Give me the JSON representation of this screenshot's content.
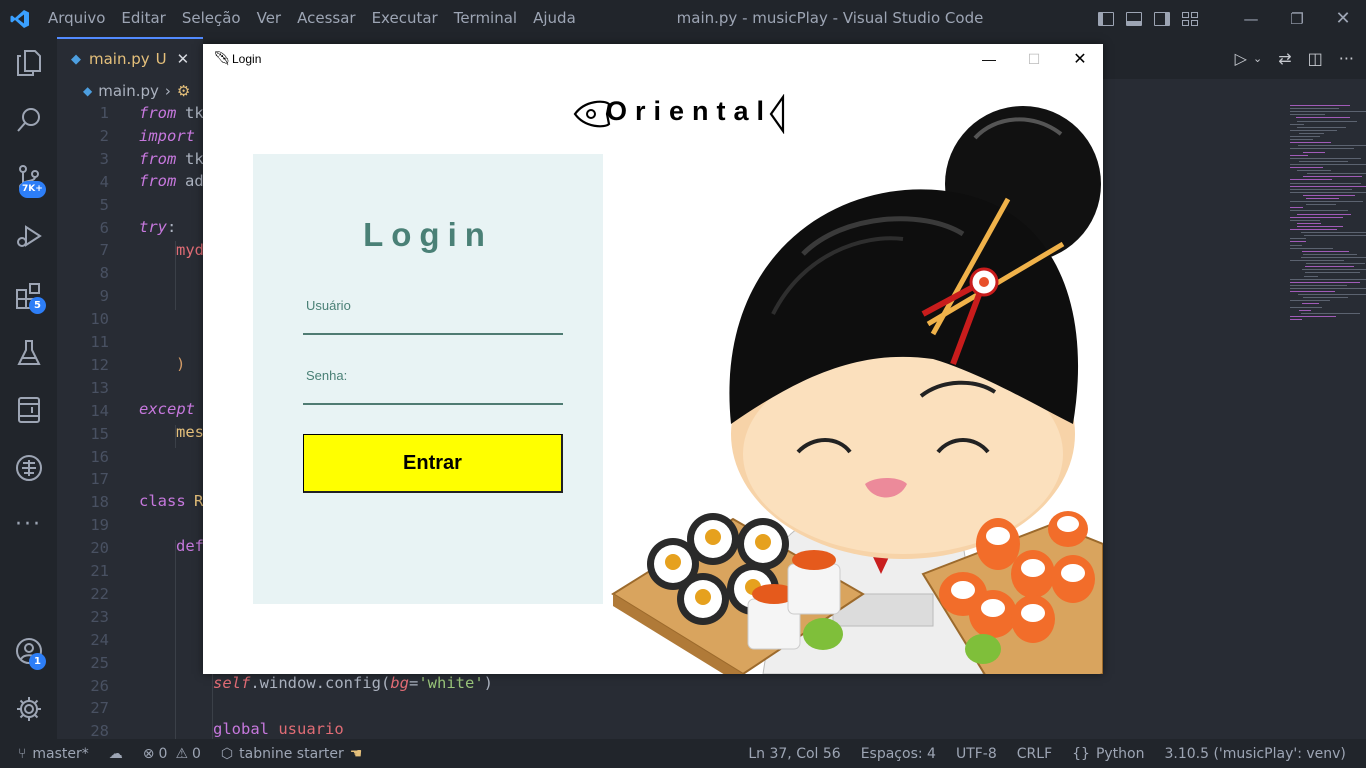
{
  "titlebar": {
    "menu": [
      "Arquivo",
      "Editar",
      "Seleção",
      "Ver",
      "Acessar",
      "Executar",
      "Terminal",
      "Ajuda"
    ],
    "window_title": "main.py - musicPlay - Visual Studio Code"
  },
  "activity": {
    "source_control_badge": "7K+",
    "extensions_badge": "5",
    "accounts_badge": "1"
  },
  "tab": {
    "filename": "main.py",
    "status": "U"
  },
  "breadcrumb": {
    "file": "main.py"
  },
  "editor": {
    "line_numbers": [
      "1",
      "2",
      "3",
      "4",
      "5",
      "6",
      "7",
      "8",
      "9",
      "10",
      "11",
      "12",
      "13",
      "14",
      "15",
      "16",
      "17",
      "18",
      "19",
      "20",
      "21",
      "22",
      "23",
      "24",
      "25",
      "26",
      "27",
      "28"
    ],
    "line1_kw": "from",
    "line1_rest": "tk",
    "line2_kw": "import",
    "line3_kw": "from",
    "line3_rest": "tk",
    "line4_kw": "from",
    "line4_rest": "ad",
    "line6_kw": "try",
    "line6_rest": ":",
    "line7_text": "myd",
    "line12_text": ")",
    "line14_kw": "except",
    "line15_text": "mes",
    "line18_kw": "class",
    "line18_rest": "R",
    "line20_kw": "def",
    "line26_self": "self",
    "line26_a": ".window.config(",
    "line26_kwarg": "bg",
    "line26_eq": "=",
    "line26_str": "'white'",
    "line26_close": ")",
    "line28_kw": "global",
    "line28_var": "usuario"
  },
  "status": {
    "branch": "master*",
    "errors": "0",
    "warnings": "0",
    "tabnine": "tabnine starter",
    "cursor": "Ln 37, Col 56",
    "spaces": "Espaços: 4",
    "encoding": "UTF-8",
    "eol": "CRLF",
    "language": "Python",
    "interpreter": "3.10.5 ('musicPlay': venv)"
  },
  "login_window": {
    "title": "Login",
    "brand": "Oriental",
    "heading": "Login",
    "user_label": "Usuário",
    "password_label": "Senha:",
    "submit_label": "Entrar",
    "colors": {
      "panel": "#e8f3f4",
      "accent": "#4a8076",
      "button": "#ffff00"
    }
  },
  "icons": [
    "vscode-logo-icon",
    "explorer-icon",
    "search-icon",
    "source-control-icon",
    "run-debug-icon",
    "extensions-icon",
    "testing-icon",
    "remote-explorer-icon",
    "accounts-icon",
    "settings-icon",
    "feather-icon",
    "fish-icon"
  ]
}
